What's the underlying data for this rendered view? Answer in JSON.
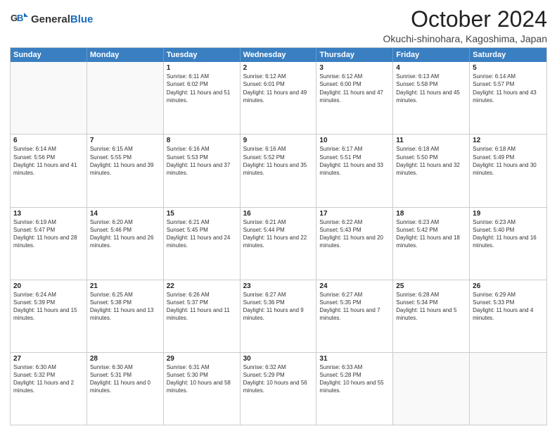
{
  "header": {
    "logo_general": "General",
    "logo_blue": "Blue",
    "month_title": "October 2024",
    "location": "Okuchi-shinohara, Kagoshima, Japan"
  },
  "days_of_week": [
    "Sunday",
    "Monday",
    "Tuesday",
    "Wednesday",
    "Thursday",
    "Friday",
    "Saturday"
  ],
  "weeks": [
    [
      {
        "day": "",
        "sunrise": "",
        "sunset": "",
        "daylight": ""
      },
      {
        "day": "",
        "sunrise": "",
        "sunset": "",
        "daylight": ""
      },
      {
        "day": "1",
        "sunrise": "Sunrise: 6:11 AM",
        "sunset": "Sunset: 6:02 PM",
        "daylight": "Daylight: 11 hours and 51 minutes."
      },
      {
        "day": "2",
        "sunrise": "Sunrise: 6:12 AM",
        "sunset": "Sunset: 6:01 PM",
        "daylight": "Daylight: 11 hours and 49 minutes."
      },
      {
        "day": "3",
        "sunrise": "Sunrise: 6:12 AM",
        "sunset": "Sunset: 6:00 PM",
        "daylight": "Daylight: 11 hours and 47 minutes."
      },
      {
        "day": "4",
        "sunrise": "Sunrise: 6:13 AM",
        "sunset": "Sunset: 5:58 PM",
        "daylight": "Daylight: 11 hours and 45 minutes."
      },
      {
        "day": "5",
        "sunrise": "Sunrise: 6:14 AM",
        "sunset": "Sunset: 5:57 PM",
        "daylight": "Daylight: 11 hours and 43 minutes."
      }
    ],
    [
      {
        "day": "6",
        "sunrise": "Sunrise: 6:14 AM",
        "sunset": "Sunset: 5:56 PM",
        "daylight": "Daylight: 11 hours and 41 minutes."
      },
      {
        "day": "7",
        "sunrise": "Sunrise: 6:15 AM",
        "sunset": "Sunset: 5:55 PM",
        "daylight": "Daylight: 11 hours and 39 minutes."
      },
      {
        "day": "8",
        "sunrise": "Sunrise: 6:16 AM",
        "sunset": "Sunset: 5:53 PM",
        "daylight": "Daylight: 11 hours and 37 minutes."
      },
      {
        "day": "9",
        "sunrise": "Sunrise: 6:16 AM",
        "sunset": "Sunset: 5:52 PM",
        "daylight": "Daylight: 11 hours and 35 minutes."
      },
      {
        "day": "10",
        "sunrise": "Sunrise: 6:17 AM",
        "sunset": "Sunset: 5:51 PM",
        "daylight": "Daylight: 11 hours and 33 minutes."
      },
      {
        "day": "11",
        "sunrise": "Sunrise: 6:18 AM",
        "sunset": "Sunset: 5:50 PM",
        "daylight": "Daylight: 11 hours and 32 minutes."
      },
      {
        "day": "12",
        "sunrise": "Sunrise: 6:18 AM",
        "sunset": "Sunset: 5:49 PM",
        "daylight": "Daylight: 11 hours and 30 minutes."
      }
    ],
    [
      {
        "day": "13",
        "sunrise": "Sunrise: 6:19 AM",
        "sunset": "Sunset: 5:47 PM",
        "daylight": "Daylight: 11 hours and 28 minutes."
      },
      {
        "day": "14",
        "sunrise": "Sunrise: 6:20 AM",
        "sunset": "Sunset: 5:46 PM",
        "daylight": "Daylight: 11 hours and 26 minutes."
      },
      {
        "day": "15",
        "sunrise": "Sunrise: 6:21 AM",
        "sunset": "Sunset: 5:45 PM",
        "daylight": "Daylight: 11 hours and 24 minutes."
      },
      {
        "day": "16",
        "sunrise": "Sunrise: 6:21 AM",
        "sunset": "Sunset: 5:44 PM",
        "daylight": "Daylight: 11 hours and 22 minutes."
      },
      {
        "day": "17",
        "sunrise": "Sunrise: 6:22 AM",
        "sunset": "Sunset: 5:43 PM",
        "daylight": "Daylight: 11 hours and 20 minutes."
      },
      {
        "day": "18",
        "sunrise": "Sunrise: 6:23 AM",
        "sunset": "Sunset: 5:42 PM",
        "daylight": "Daylight: 11 hours and 18 minutes."
      },
      {
        "day": "19",
        "sunrise": "Sunrise: 6:23 AM",
        "sunset": "Sunset: 5:40 PM",
        "daylight": "Daylight: 11 hours and 16 minutes."
      }
    ],
    [
      {
        "day": "20",
        "sunrise": "Sunrise: 6:24 AM",
        "sunset": "Sunset: 5:39 PM",
        "daylight": "Daylight: 11 hours and 15 minutes."
      },
      {
        "day": "21",
        "sunrise": "Sunrise: 6:25 AM",
        "sunset": "Sunset: 5:38 PM",
        "daylight": "Daylight: 11 hours and 13 minutes."
      },
      {
        "day": "22",
        "sunrise": "Sunrise: 6:26 AM",
        "sunset": "Sunset: 5:37 PM",
        "daylight": "Daylight: 11 hours and 11 minutes."
      },
      {
        "day": "23",
        "sunrise": "Sunrise: 6:27 AM",
        "sunset": "Sunset: 5:36 PM",
        "daylight": "Daylight: 11 hours and 9 minutes."
      },
      {
        "day": "24",
        "sunrise": "Sunrise: 6:27 AM",
        "sunset": "Sunset: 5:35 PM",
        "daylight": "Daylight: 11 hours and 7 minutes."
      },
      {
        "day": "25",
        "sunrise": "Sunrise: 6:28 AM",
        "sunset": "Sunset: 5:34 PM",
        "daylight": "Daylight: 11 hours and 5 minutes."
      },
      {
        "day": "26",
        "sunrise": "Sunrise: 6:29 AM",
        "sunset": "Sunset: 5:33 PM",
        "daylight": "Daylight: 11 hours and 4 minutes."
      }
    ],
    [
      {
        "day": "27",
        "sunrise": "Sunrise: 6:30 AM",
        "sunset": "Sunset: 5:32 PM",
        "daylight": "Daylight: 11 hours and 2 minutes."
      },
      {
        "day": "28",
        "sunrise": "Sunrise: 6:30 AM",
        "sunset": "Sunset: 5:31 PM",
        "daylight": "Daylight: 11 hours and 0 minutes."
      },
      {
        "day": "29",
        "sunrise": "Sunrise: 6:31 AM",
        "sunset": "Sunset: 5:30 PM",
        "daylight": "Daylight: 10 hours and 58 minutes."
      },
      {
        "day": "30",
        "sunrise": "Sunrise: 6:32 AM",
        "sunset": "Sunset: 5:29 PM",
        "daylight": "Daylight: 10 hours and 56 minutes."
      },
      {
        "day": "31",
        "sunrise": "Sunrise: 6:33 AM",
        "sunset": "Sunset: 5:28 PM",
        "daylight": "Daylight: 10 hours and 55 minutes."
      },
      {
        "day": "",
        "sunrise": "",
        "sunset": "",
        "daylight": ""
      },
      {
        "day": "",
        "sunrise": "",
        "sunset": "",
        "daylight": ""
      }
    ]
  ]
}
